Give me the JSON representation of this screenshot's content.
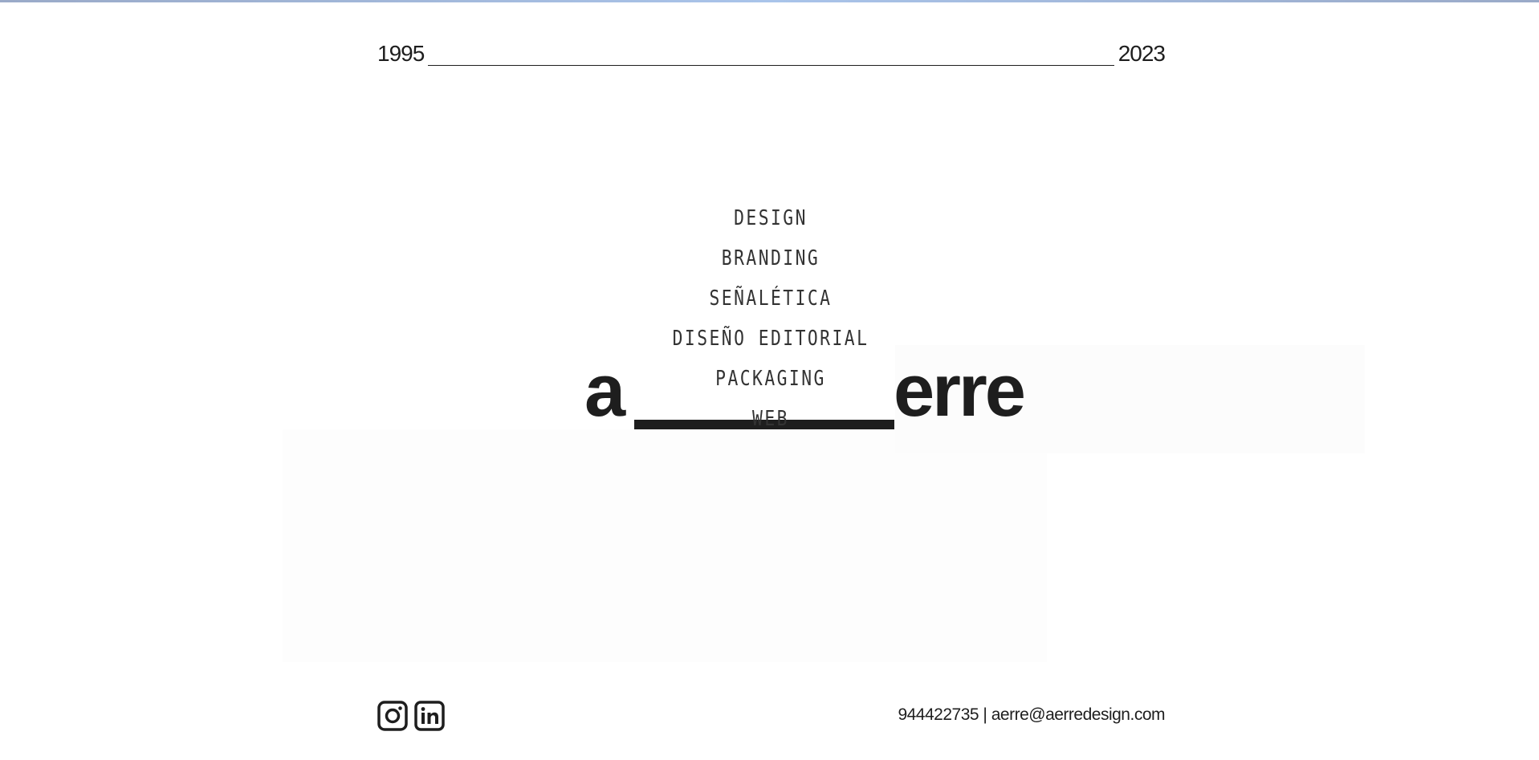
{
  "timeline": {
    "start_year": "1995",
    "end_year": "2023"
  },
  "brand": {
    "logo_left": "a",
    "logo_right": "erre"
  },
  "services": [
    "DESIGN",
    "BRANDING",
    "SEÑALÉTICA",
    "DISEÑO EDITORIAL",
    "PACKAGING",
    "WEB"
  ],
  "footer": {
    "social": [
      {
        "icon": "instagram-icon"
      },
      {
        "icon": "linkedin-icon"
      }
    ],
    "phone": "944422735",
    "separator": "|",
    "email": "aerre@aerredesign.com"
  },
  "colors": {
    "text": "#1e1e1e",
    "background": "#ffffff",
    "top_accent": "#a9c4ea"
  }
}
